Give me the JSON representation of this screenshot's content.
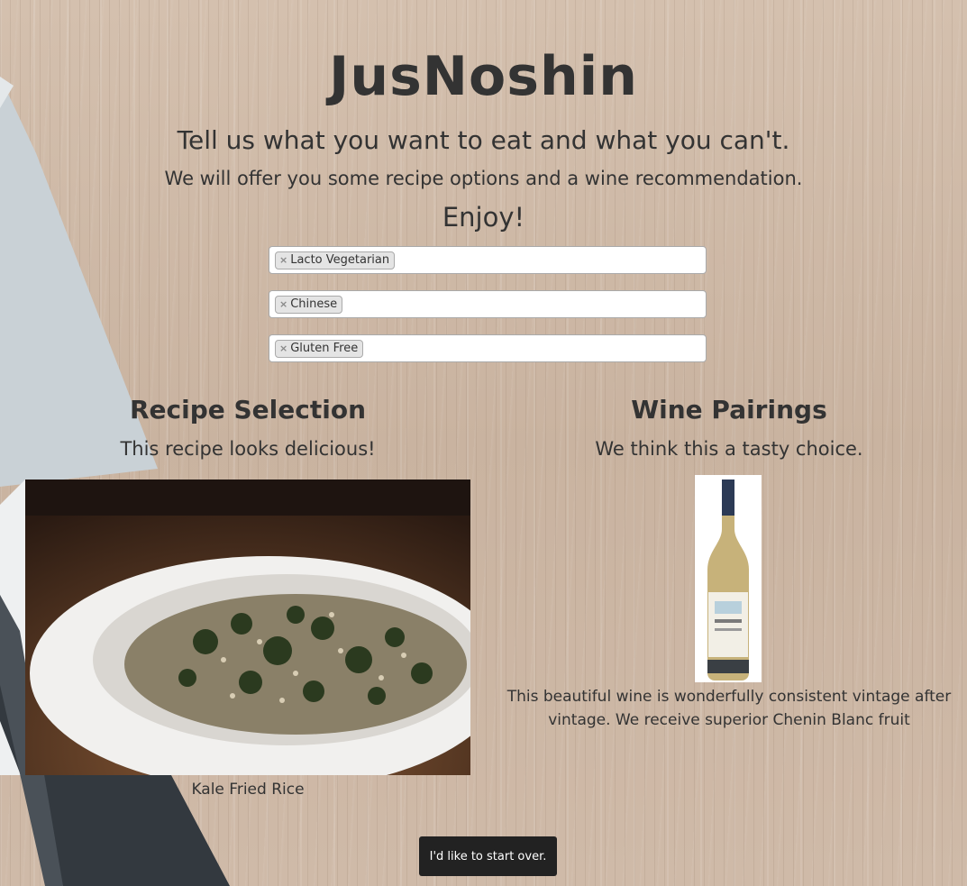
{
  "header": {
    "site_title": "JusNoshin",
    "subtitle": "Tell us what you want to eat and what you can't.",
    "tagline": "We will offer you some recipe options and a wine recommendation.",
    "enjoy": "Enjoy!"
  },
  "filters": [
    {
      "tag": "Lacto Vegetarian",
      "remove": "×"
    },
    {
      "tag": "Chinese",
      "remove": "×"
    },
    {
      "tag": "Gluten Free",
      "remove": "×"
    }
  ],
  "recipe": {
    "section_title": "Recipe Selection",
    "section_sub": "This recipe looks delicious!",
    "name": "Kale Fried Rice"
  },
  "wine": {
    "section_title": "Wine Pairings",
    "section_sub": "We think this a tasty choice.",
    "description": "This beautiful wine is wonderfully consistent vintage after vintage. We receive superior Chenin Blanc fruit"
  },
  "actions": {
    "start_over": "I'd like to start over."
  },
  "colors": {
    "button_bg": "#222222",
    "text": "#333333",
    "wood": "#cdb8a6"
  }
}
